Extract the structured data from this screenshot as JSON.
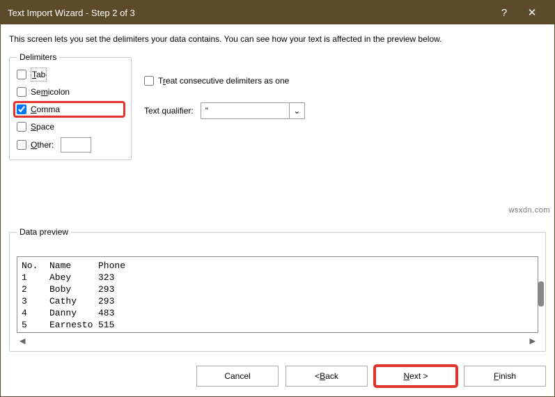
{
  "title": "Text Import Wizard - Step 2 of 3",
  "description": "This screen lets you set the delimiters your data contains.  You can see how your text is affected in the preview below.",
  "delimiters": {
    "legend": "Delimiters",
    "tab": "Tab",
    "semicolon": "Semicolon",
    "comma": "Comma",
    "space": "Space",
    "other": "Other:"
  },
  "options": {
    "treat_consecutive": "Treat consecutive delimiters as one",
    "qualifier_label": "Text qualifier:",
    "qualifier_value": "\""
  },
  "preview": {
    "legend": "Data preview",
    "header0": "No.",
    "header1": "Name",
    "header2": "Phone",
    "r0c0": "1",
    "r0c1": "Abey",
    "r0c2": "323",
    "r1c0": "2",
    "r1c1": "Boby",
    "r1c2": "293",
    "r2c0": "3",
    "r2c1": "Cathy",
    "r2c2": "293",
    "r3c0": "4",
    "r3c1": "Danny",
    "r3c2": "483",
    "r4c0": "5",
    "r4c1": "Earnesto",
    "r4c2": "515"
  },
  "buttons": {
    "cancel": "Cancel",
    "back": "< Back",
    "next": "Next >",
    "finish": "Finish"
  },
  "watermark": "wsxdn.com",
  "glyphs": {
    "help": "?",
    "close": "✕",
    "chev": "⌄",
    "ltri": "◀",
    "rtri": "▶"
  }
}
